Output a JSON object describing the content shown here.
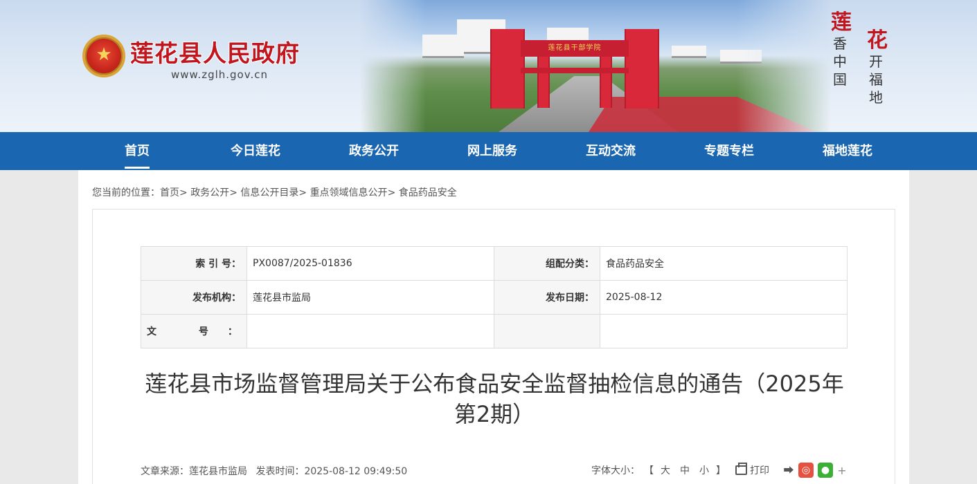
{
  "header": {
    "site_title": "莲花县人民政府",
    "site_url": "www.zglh.gov.cn",
    "gate_sign": "莲花县干部学院",
    "motto_left": [
      "莲",
      "香",
      "中",
      "国"
    ],
    "motto_right": [
      "花",
      "开",
      "福",
      "地"
    ],
    "emblem_glyph": "★"
  },
  "nav": {
    "items": [
      {
        "label": "首页",
        "active": true
      },
      {
        "label": "今日莲花"
      },
      {
        "label": "政务公开"
      },
      {
        "label": "网上服务"
      },
      {
        "label": "互动交流"
      },
      {
        "label": "专题专栏"
      },
      {
        "label": "福地莲花"
      }
    ]
  },
  "breadcrumb": {
    "prefix": "您当前的位置：",
    "items": [
      "首页",
      "政务公开",
      "信息公开目录",
      "重点领域信息公开",
      "食品药品安全"
    ],
    "separator": ">"
  },
  "meta": {
    "index_label": "索 引 号：",
    "index_value": "PX0087/2025-01836",
    "category_label": "组配分类：",
    "category_value": "食品药品安全",
    "publisher_label": "发布机构：",
    "publisher_value": "莲花县市监局",
    "date_label": "发布日期：",
    "date_value": "2025-08-12",
    "docno_label": "文 号：",
    "docno_value": "",
    "empty_label": "",
    "empty_value": ""
  },
  "article": {
    "title": "莲花县市场监督管理局关于公布食品安全监督抽检信息的通告（2025年第2期）",
    "source": "文章来源：莲花县市监局",
    "publish_time": "发表时间：2025-08-12 09:49:50",
    "font_size_label": "字体大小：",
    "font_open": "【",
    "font_large": "大",
    "font_medium": "中",
    "font_small": "小",
    "font_close": "】",
    "print_label": "打印"
  },
  "icons": {
    "share": "share-icon",
    "weibo": "weibo-icon",
    "wechat": "wechat-icon",
    "plus": "plus-icon",
    "print": "printer-icon"
  },
  "colors": {
    "nav_bg": "#1a66b0",
    "title_red": "#c2161f",
    "weibo": "#e6503f",
    "wechat": "#3cb034"
  }
}
